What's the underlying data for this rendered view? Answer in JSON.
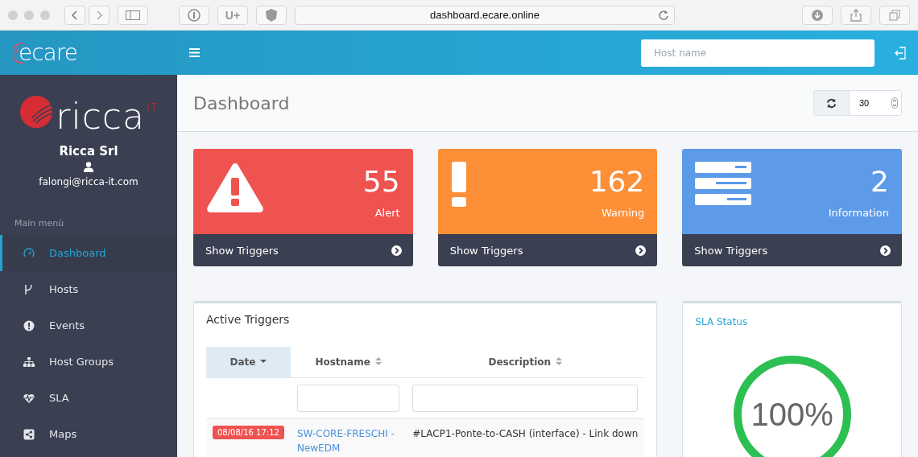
{
  "browser": {
    "url": "dashboard.ecare.online",
    "buttons": [
      "U+"
    ]
  },
  "header": {
    "logo": "ecare",
    "search": {
      "placeholder": "Host name"
    }
  },
  "sidebar": {
    "logo": {
      "text": "ricca",
      "sup": "IT"
    },
    "company": "Ricca Srl",
    "email": "falongi@ricca-it.com",
    "section": "Main menù",
    "items": [
      {
        "label": "Dashboard",
        "selected": true
      },
      {
        "label": "Hosts",
        "selected": false
      },
      {
        "label": "Events",
        "selected": false
      },
      {
        "label": "Host Groups",
        "selected": false
      },
      {
        "label": "SLA",
        "selected": false
      },
      {
        "label": "Maps",
        "selected": false
      }
    ]
  },
  "page": {
    "title": "Dashboard",
    "refresh_value": "30"
  },
  "cards": [
    {
      "kind": "alert",
      "count": "55",
      "label": "Alert",
      "link": "Show Triggers"
    },
    {
      "kind": "warning",
      "count": "162",
      "label": "Warning",
      "link": "Show Triggers"
    },
    {
      "kind": "information",
      "count": "2",
      "label": "Information",
      "link": "Show Triggers"
    }
  ],
  "triggers": {
    "title": "Active Triggers",
    "columns": [
      {
        "label": "Date",
        "selected": true
      },
      {
        "label": "Hostname",
        "selected": false
      },
      {
        "label": "Description",
        "selected": false
      }
    ],
    "rows": [
      {
        "date": "08/08/16 17:12",
        "hostname": "SW-CORE-FRESCHI - NewEDM",
        "description": "#LACP1-Ponte-to-CASH (interface) - Link down"
      }
    ]
  },
  "sla": {
    "title": "SLA Status",
    "value": "100%"
  }
}
